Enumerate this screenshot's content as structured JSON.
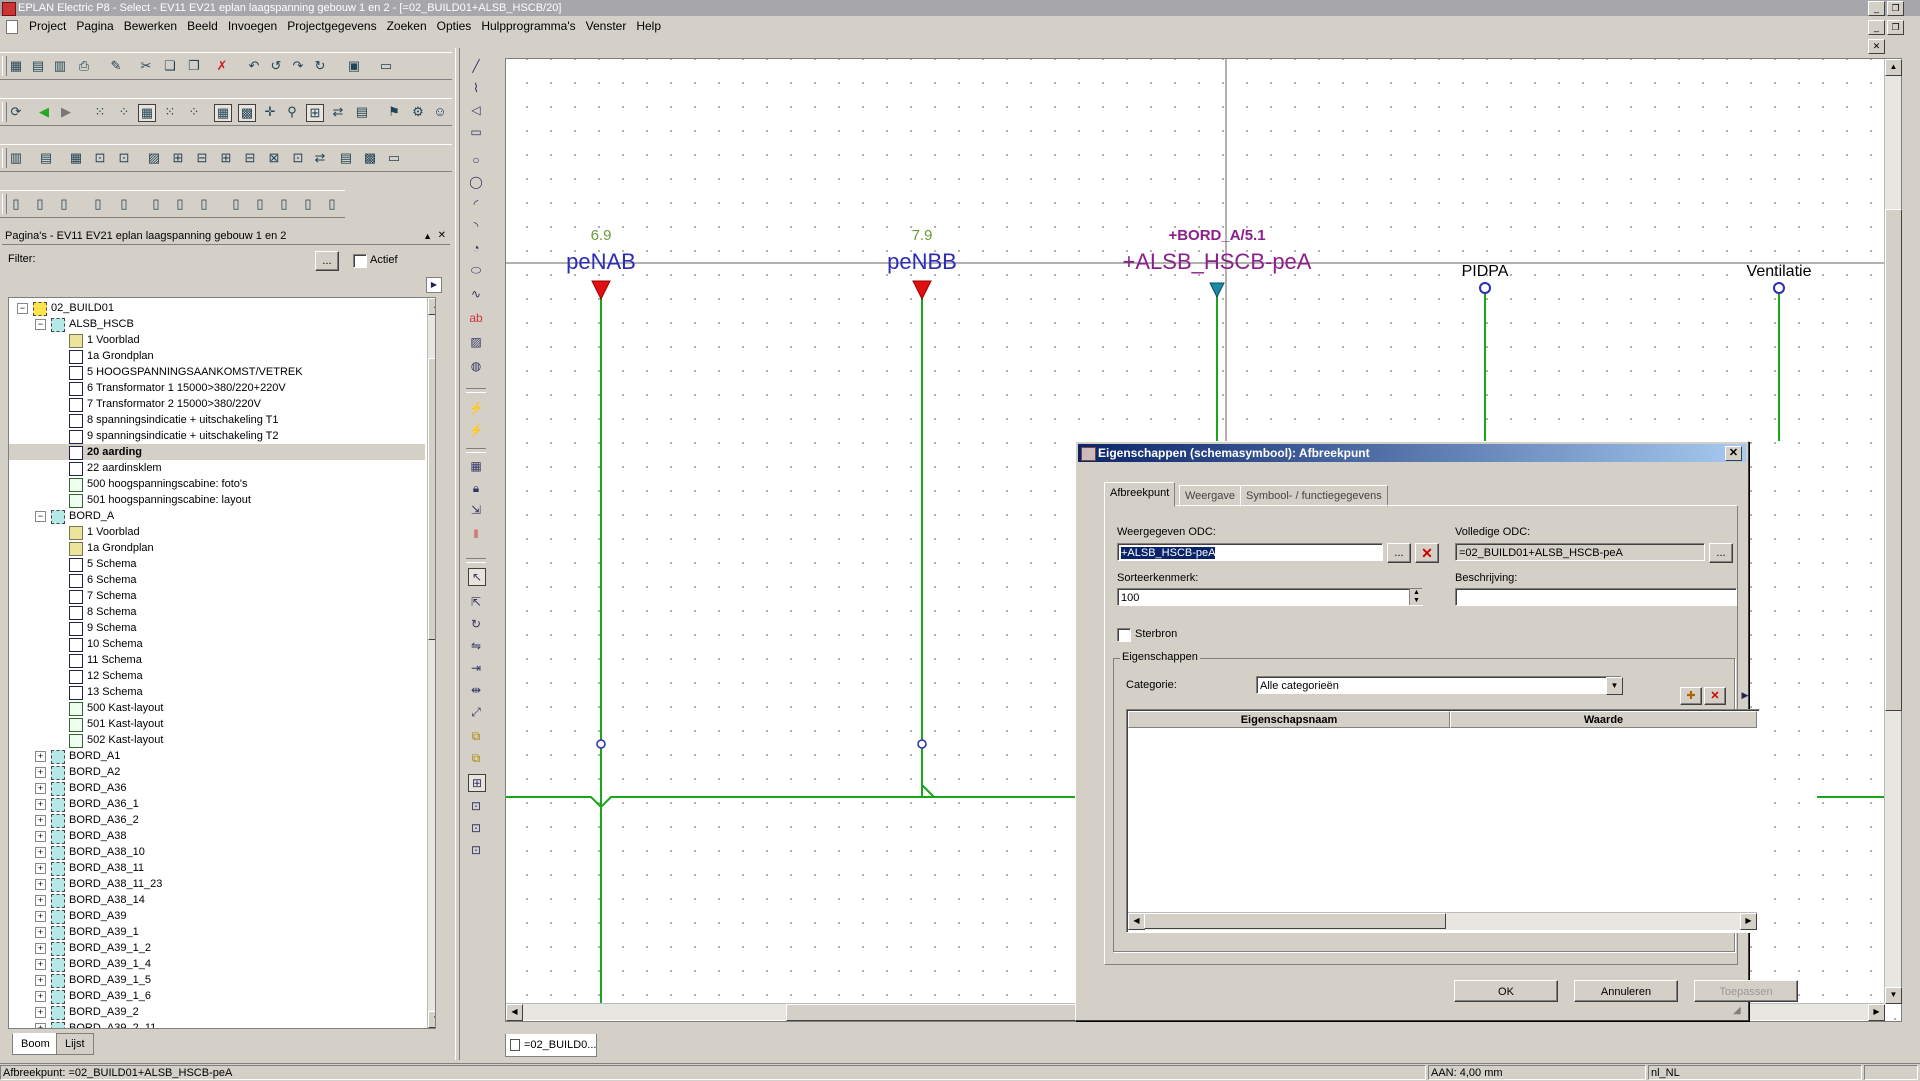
{
  "window": {
    "title": "EPLAN Electric P8 - Select - EV11 EV21 eplan laagspanning gebouw 1 en 2 - [=02_BUILD01+ALSB_HSCB/20]"
  },
  "menu": [
    "Project",
    "Pagina",
    "Bewerken",
    "Beeld",
    "Invoegen",
    "Projectgegevens",
    "Zoeken",
    "Opties",
    "Hulpprogramma's",
    "Venster",
    "Help"
  ],
  "panel": {
    "title": "Pagina's - EV11 EV21 eplan laagspanning gebouw 1 en 2",
    "filter_label": "Filter:",
    "filter_button": "...",
    "actief_label": "Actief",
    "tabs": [
      "Boom",
      "Lijst"
    ],
    "tree": [
      {
        "label": "02_BUILD01",
        "level": 1,
        "icon": "build",
        "exp": "-"
      },
      {
        "label": "ALSB_HSCB",
        "level": 2,
        "icon": "folder",
        "exp": "-"
      },
      {
        "label": "1 Voorblad",
        "level": 3,
        "icon": "cover"
      },
      {
        "label": "1a Grondplan",
        "level": 3,
        "icon": "schema"
      },
      {
        "label": "5 HOOGSPANNINGSAANKOMST/VETREK",
        "level": 3,
        "icon": "schema"
      },
      {
        "label": "6 Transformator 1      15000>380/220+220V",
        "level": 3,
        "icon": "schema"
      },
      {
        "label": "7 Transformator 2      15000>380/220V",
        "level": 3,
        "icon": "schema"
      },
      {
        "label": "8 spanningsindicatie + uitschakeling T1",
        "level": 3,
        "icon": "schema"
      },
      {
        "label": "9 spanningsindicatie + uitschakeling T2",
        "level": 3,
        "icon": "schema"
      },
      {
        "label": "20 aarding",
        "level": 3,
        "icon": "schema",
        "selected": true
      },
      {
        "label": "22 aardinsklem",
        "level": 3,
        "icon": "schema"
      },
      {
        "label": "500 hoogspanningscabine: foto's",
        "level": 3,
        "icon": "layout"
      },
      {
        "label": "501 hoogspanningscabine: layout",
        "level": 3,
        "icon": "layout"
      },
      {
        "label": "BORD_A",
        "level": 2,
        "icon": "folder",
        "exp": "-"
      },
      {
        "label": "1 Voorblad",
        "level": 3,
        "icon": "cover"
      },
      {
        "label": "1a Grondplan",
        "level": 3,
        "icon": "cover"
      },
      {
        "label": "5 Schema",
        "level": 3,
        "icon": "schema"
      },
      {
        "label": "6 Schema",
        "level": 3,
        "icon": "schema"
      },
      {
        "label": "7 Schema",
        "level": 3,
        "icon": "schema"
      },
      {
        "label": "8 Schema",
        "level": 3,
        "icon": "schema"
      },
      {
        "label": "9 Schema",
        "level": 3,
        "icon": "schema"
      },
      {
        "label": "10 Schema",
        "level": 3,
        "icon": "schema"
      },
      {
        "label": "11 Schema",
        "level": 3,
        "icon": "schema"
      },
      {
        "label": "12 Schema",
        "level": 3,
        "icon": "schema"
      },
      {
        "label": "13 Schema",
        "level": 3,
        "icon": "schema"
      },
      {
        "label": "500 Kast-layout",
        "level": 3,
        "icon": "layout"
      },
      {
        "label": "501 Kast-layout",
        "level": 3,
        "icon": "layout"
      },
      {
        "label": "502 Kast-layout",
        "level": 3,
        "icon": "layout"
      },
      {
        "label": "BORD_A1",
        "level": 2,
        "icon": "folder",
        "exp": "+"
      },
      {
        "label": "BORD_A2",
        "level": 2,
        "icon": "folder",
        "exp": "+"
      },
      {
        "label": "BORD_A36",
        "level": 2,
        "icon": "folder",
        "exp": "+"
      },
      {
        "label": "BORD_A36_1",
        "level": 2,
        "icon": "folder",
        "exp": "+"
      },
      {
        "label": "BORD_A36_2",
        "level": 2,
        "icon": "folder",
        "exp": "+"
      },
      {
        "label": "BORD_A38",
        "level": 2,
        "icon": "folder",
        "exp": "+"
      },
      {
        "label": "BORD_A38_10",
        "level": 2,
        "icon": "folder",
        "exp": "+"
      },
      {
        "label": "BORD_A38_11",
        "level": 2,
        "icon": "folder",
        "exp": "+"
      },
      {
        "label": "BORD_A38_11_23",
        "level": 2,
        "icon": "folder",
        "exp": "+"
      },
      {
        "label": "BORD_A38_14",
        "level": 2,
        "icon": "folder",
        "exp": "+"
      },
      {
        "label": "BORD_A39",
        "level": 2,
        "icon": "folder",
        "exp": "+"
      },
      {
        "label": "BORD_A39_1",
        "level": 2,
        "icon": "folder",
        "exp": "+"
      },
      {
        "label": "BORD_A39_1_2",
        "level": 2,
        "icon": "folder",
        "exp": "+"
      },
      {
        "label": "BORD_A39_1_4",
        "level": 2,
        "icon": "folder",
        "exp": "+"
      },
      {
        "label": "BORD_A39_1_5",
        "level": 2,
        "icon": "folder",
        "exp": "+"
      },
      {
        "label": "BORD_A39_1_6",
        "level": 2,
        "icon": "folder",
        "exp": "+"
      },
      {
        "label": "BORD_A39_2",
        "level": 2,
        "icon": "folder",
        "exp": "+"
      },
      {
        "label": "BORD_A39_2_11",
        "level": 2,
        "icon": "folder",
        "exp": "+"
      }
    ]
  },
  "schematic": {
    "symbols": [
      {
        "ref": "6.9",
        "name": "peNAB",
        "ref_color": "#6a9a38",
        "name_color": "#2b2bb8",
        "type": "arrow"
      },
      {
        "ref": "7.9",
        "name": "peNBB",
        "ref_color": "#6a9a38",
        "name_color": "#2b2bb8",
        "type": "arrow"
      },
      {
        "ref": "+BORD_A/5.1",
        "name": "+ALSB_HSCB-peA",
        "ref_color": "#8b1f8b",
        "name_color": "#8b1f8b",
        "type": "selected"
      },
      {
        "name": "PIDPA",
        "name_color": "#000000",
        "type": "circle"
      },
      {
        "name": "Ventilatie",
        "name_color": "#000000",
        "type": "circle"
      }
    ],
    "wire_color": "#1aa61a"
  },
  "doc_tab": "=02_BUILD0...",
  "dialog": {
    "title": "Eigenschappen (schemasymbool): Afbreekpunt",
    "tabs": [
      "Afbreekpunt",
      "Weergave",
      "Symbool- / functiegegevens"
    ],
    "weergegeven_label": "Weergegeven ODC:",
    "weergegeven_value": "+ALSB_HSCB-peA",
    "volledige_label": "Volledige ODC:",
    "volledige_value": "=02_BUILD01+ALSB_HSCB-peA",
    "sorteer_label": "Sorteerkenmerk:",
    "sorteer_value": "100",
    "beschrijving_label": "Beschrijving:",
    "beschrijving_value": "",
    "sterbron_label": "Sterbron",
    "group_label": "Eigenschappen",
    "categorie_label": "Categorie:",
    "categorie_value": "Alle categorieën",
    "col_name": "Eigenschapsnaam",
    "col_value": "Waarde",
    "ok": "OK",
    "cancel": "Annuleren",
    "apply": "Toepassen",
    "ellipsis": "..."
  },
  "status": {
    "left": "Afbreekpunt: =02_BUILD01+ALSB_HSCB-peA",
    "mid": "AAN: 4,00 mm",
    "lang": "nl_NL"
  }
}
